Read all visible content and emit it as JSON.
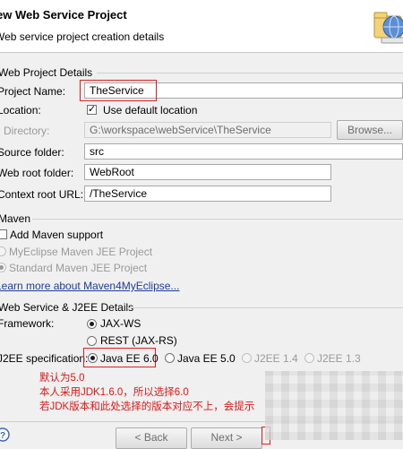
{
  "header": {
    "title": "ew Web Service Project",
    "subtitle": "Web service project creation details",
    "logo_icon": "web-service-wizard-icon"
  },
  "web_project_details": {
    "group_label": "Web Project Details",
    "project_name_label": "Project Name:",
    "project_name_value": "TheService",
    "location_label": "Location:",
    "use_default_location_label": "Use default location",
    "use_default_location_checked": true,
    "directory_label": "Directory:",
    "directory_value": "G:\\workspace\\webService\\TheService",
    "browse_label": "Browse...",
    "source_folder_label": "Source folder:",
    "source_folder_value": "src",
    "web_root_label": "Web root folder:",
    "web_root_value": "WebRoot",
    "context_root_label": "Context root URL:",
    "context_root_value": "/TheService"
  },
  "maven": {
    "group_label": "Maven",
    "add_support_label": "Add Maven support",
    "add_support_checked": false,
    "myeclipse_jee_label": "MyEclipse Maven JEE Project",
    "standard_jee_label": "Standard Maven JEE Project",
    "learn_more_label": "Learn more about Maven4MyEclipse..."
  },
  "ws_j2ee": {
    "group_label": "Web Service & J2EE Details",
    "framework_label": "Framework:",
    "framework_options": [
      "JAX-WS",
      "REST (JAX-RS)"
    ],
    "framework_selected": "JAX-WS",
    "spec_label": "J2EE specification:",
    "spec_options": [
      "Java EE 6.0",
      "Java EE 5.0",
      "J2EE 1.4",
      "J2EE 1.3"
    ],
    "spec_selected": "Java EE 6.0"
  },
  "annotation": {
    "line1": "默认为5.0",
    "line2": "本人采用JDK1.6.0，所以选择6.0",
    "line3": "若JDK版本和此处选择的版本对应不上，会提示",
    "color": "#e01818"
  },
  "footer": {
    "help_icon": "help-icon",
    "back_label": "< Back",
    "next_label": "Next >"
  }
}
